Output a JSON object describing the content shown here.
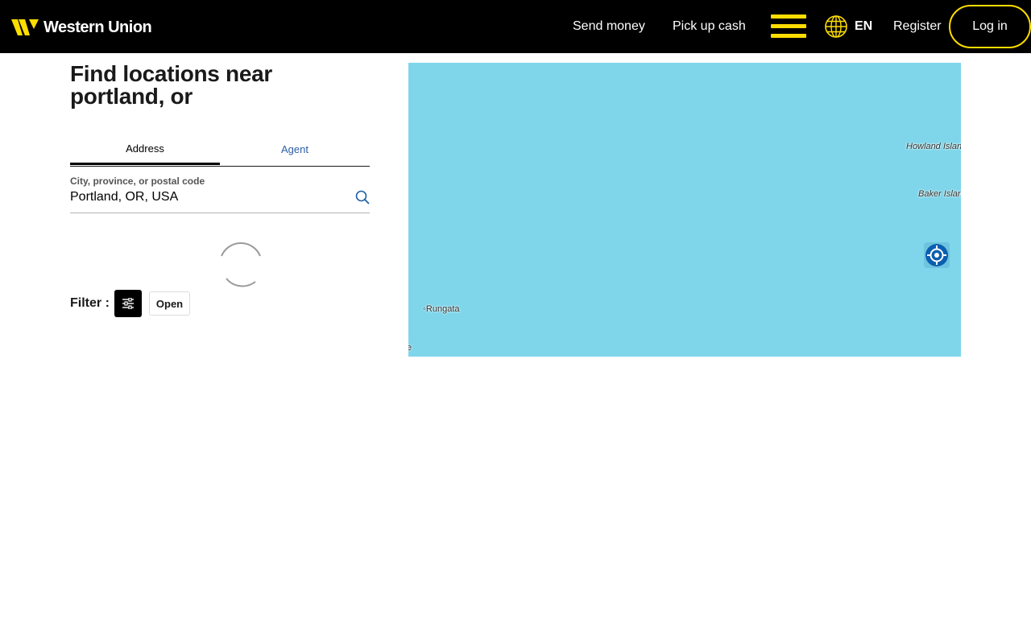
{
  "header": {
    "brand": "Western Union",
    "nav": {
      "send_money": "Send money",
      "pick_up_cash": "Pick up cash",
      "register": "Register",
      "login": "Log in"
    },
    "language": "EN",
    "colors": {
      "background": "#000000",
      "accent": "#ffdd00"
    }
  },
  "page": {
    "title": "Find locations near portland, or",
    "tabs": [
      {
        "label": "Address",
        "active": true
      },
      {
        "label": "Agent",
        "active": false
      }
    ],
    "search": {
      "label": "City, province, or postal code",
      "value": "Portland, OR, USA"
    },
    "filter": {
      "label": "Filter :",
      "open_button": "Open"
    }
  },
  "map": {
    "labels": {
      "howland": "Howland Island",
      "baker": "Baker Island",
      "rungata": "Rungata",
      "edge": "e"
    },
    "water_color": "#7fd6ea"
  },
  "icons": [
    "western-union-logo",
    "hamburger-menu-icon",
    "globe-icon",
    "search-icon",
    "loading-spinner",
    "filter-sliders-icon",
    "locate-me-icon"
  ]
}
